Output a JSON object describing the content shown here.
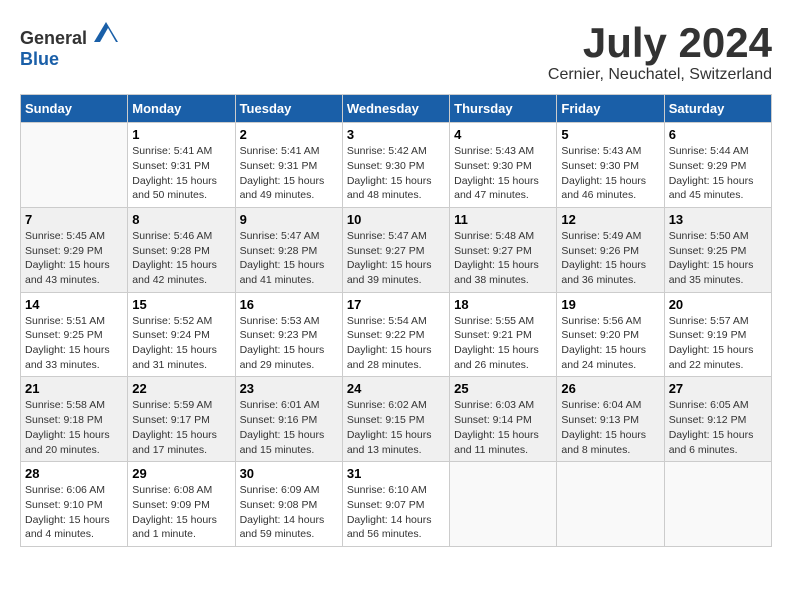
{
  "header": {
    "logo_general": "General",
    "logo_blue": "Blue",
    "month_title": "July 2024",
    "location": "Cernier, Neuchatel, Switzerland"
  },
  "days_of_week": [
    "Sunday",
    "Monday",
    "Tuesday",
    "Wednesday",
    "Thursday",
    "Friday",
    "Saturday"
  ],
  "weeks": [
    [
      {
        "day": "",
        "sunrise": "",
        "sunset": "",
        "daylight": "",
        "empty": true
      },
      {
        "day": "1",
        "sunrise": "Sunrise: 5:41 AM",
        "sunset": "Sunset: 9:31 PM",
        "daylight": "Daylight: 15 hours and 50 minutes.",
        "empty": false
      },
      {
        "day": "2",
        "sunrise": "Sunrise: 5:41 AM",
        "sunset": "Sunset: 9:31 PM",
        "daylight": "Daylight: 15 hours and 49 minutes.",
        "empty": false
      },
      {
        "day": "3",
        "sunrise": "Sunrise: 5:42 AM",
        "sunset": "Sunset: 9:30 PM",
        "daylight": "Daylight: 15 hours and 48 minutes.",
        "empty": false
      },
      {
        "day": "4",
        "sunrise": "Sunrise: 5:43 AM",
        "sunset": "Sunset: 9:30 PM",
        "daylight": "Daylight: 15 hours and 47 minutes.",
        "empty": false
      },
      {
        "day": "5",
        "sunrise": "Sunrise: 5:43 AM",
        "sunset": "Sunset: 9:30 PM",
        "daylight": "Daylight: 15 hours and 46 minutes.",
        "empty": false
      },
      {
        "day": "6",
        "sunrise": "Sunrise: 5:44 AM",
        "sunset": "Sunset: 9:29 PM",
        "daylight": "Daylight: 15 hours and 45 minutes.",
        "empty": false
      }
    ],
    [
      {
        "day": "7",
        "sunrise": "Sunrise: 5:45 AM",
        "sunset": "Sunset: 9:29 PM",
        "daylight": "Daylight: 15 hours and 43 minutes.",
        "empty": false
      },
      {
        "day": "8",
        "sunrise": "Sunrise: 5:46 AM",
        "sunset": "Sunset: 9:28 PM",
        "daylight": "Daylight: 15 hours and 42 minutes.",
        "empty": false
      },
      {
        "day": "9",
        "sunrise": "Sunrise: 5:47 AM",
        "sunset": "Sunset: 9:28 PM",
        "daylight": "Daylight: 15 hours and 41 minutes.",
        "empty": false
      },
      {
        "day": "10",
        "sunrise": "Sunrise: 5:47 AM",
        "sunset": "Sunset: 9:27 PM",
        "daylight": "Daylight: 15 hours and 39 minutes.",
        "empty": false
      },
      {
        "day": "11",
        "sunrise": "Sunrise: 5:48 AM",
        "sunset": "Sunset: 9:27 PM",
        "daylight": "Daylight: 15 hours and 38 minutes.",
        "empty": false
      },
      {
        "day": "12",
        "sunrise": "Sunrise: 5:49 AM",
        "sunset": "Sunset: 9:26 PM",
        "daylight": "Daylight: 15 hours and 36 minutes.",
        "empty": false
      },
      {
        "day": "13",
        "sunrise": "Sunrise: 5:50 AM",
        "sunset": "Sunset: 9:25 PM",
        "daylight": "Daylight: 15 hours and 35 minutes.",
        "empty": false
      }
    ],
    [
      {
        "day": "14",
        "sunrise": "Sunrise: 5:51 AM",
        "sunset": "Sunset: 9:25 PM",
        "daylight": "Daylight: 15 hours and 33 minutes.",
        "empty": false
      },
      {
        "day": "15",
        "sunrise": "Sunrise: 5:52 AM",
        "sunset": "Sunset: 9:24 PM",
        "daylight": "Daylight: 15 hours and 31 minutes.",
        "empty": false
      },
      {
        "day": "16",
        "sunrise": "Sunrise: 5:53 AM",
        "sunset": "Sunset: 9:23 PM",
        "daylight": "Daylight: 15 hours and 29 minutes.",
        "empty": false
      },
      {
        "day": "17",
        "sunrise": "Sunrise: 5:54 AM",
        "sunset": "Sunset: 9:22 PM",
        "daylight": "Daylight: 15 hours and 28 minutes.",
        "empty": false
      },
      {
        "day": "18",
        "sunrise": "Sunrise: 5:55 AM",
        "sunset": "Sunset: 9:21 PM",
        "daylight": "Daylight: 15 hours and 26 minutes.",
        "empty": false
      },
      {
        "day": "19",
        "sunrise": "Sunrise: 5:56 AM",
        "sunset": "Sunset: 9:20 PM",
        "daylight": "Daylight: 15 hours and 24 minutes.",
        "empty": false
      },
      {
        "day": "20",
        "sunrise": "Sunrise: 5:57 AM",
        "sunset": "Sunset: 9:19 PM",
        "daylight": "Daylight: 15 hours and 22 minutes.",
        "empty": false
      }
    ],
    [
      {
        "day": "21",
        "sunrise": "Sunrise: 5:58 AM",
        "sunset": "Sunset: 9:18 PM",
        "daylight": "Daylight: 15 hours and 20 minutes.",
        "empty": false
      },
      {
        "day": "22",
        "sunrise": "Sunrise: 5:59 AM",
        "sunset": "Sunset: 9:17 PM",
        "daylight": "Daylight: 15 hours and 17 minutes.",
        "empty": false
      },
      {
        "day": "23",
        "sunrise": "Sunrise: 6:01 AM",
        "sunset": "Sunset: 9:16 PM",
        "daylight": "Daylight: 15 hours and 15 minutes.",
        "empty": false
      },
      {
        "day": "24",
        "sunrise": "Sunrise: 6:02 AM",
        "sunset": "Sunset: 9:15 PM",
        "daylight": "Daylight: 15 hours and 13 minutes.",
        "empty": false
      },
      {
        "day": "25",
        "sunrise": "Sunrise: 6:03 AM",
        "sunset": "Sunset: 9:14 PM",
        "daylight": "Daylight: 15 hours and 11 minutes.",
        "empty": false
      },
      {
        "day": "26",
        "sunrise": "Sunrise: 6:04 AM",
        "sunset": "Sunset: 9:13 PM",
        "daylight": "Daylight: 15 hours and 8 minutes.",
        "empty": false
      },
      {
        "day": "27",
        "sunrise": "Sunrise: 6:05 AM",
        "sunset": "Sunset: 9:12 PM",
        "daylight": "Daylight: 15 hours and 6 minutes.",
        "empty": false
      }
    ],
    [
      {
        "day": "28",
        "sunrise": "Sunrise: 6:06 AM",
        "sunset": "Sunset: 9:10 PM",
        "daylight": "Daylight: 15 hours and 4 minutes.",
        "empty": false
      },
      {
        "day": "29",
        "sunrise": "Sunrise: 6:08 AM",
        "sunset": "Sunset: 9:09 PM",
        "daylight": "Daylight: 15 hours and 1 minute.",
        "empty": false
      },
      {
        "day": "30",
        "sunrise": "Sunrise: 6:09 AM",
        "sunset": "Sunset: 9:08 PM",
        "daylight": "Daylight: 14 hours and 59 minutes.",
        "empty": false
      },
      {
        "day": "31",
        "sunrise": "Sunrise: 6:10 AM",
        "sunset": "Sunset: 9:07 PM",
        "daylight": "Daylight: 14 hours and 56 minutes.",
        "empty": false
      },
      {
        "day": "",
        "sunrise": "",
        "sunset": "",
        "daylight": "",
        "empty": true
      },
      {
        "day": "",
        "sunrise": "",
        "sunset": "",
        "daylight": "",
        "empty": true
      },
      {
        "day": "",
        "sunrise": "",
        "sunset": "",
        "daylight": "",
        "empty": true
      }
    ]
  ]
}
